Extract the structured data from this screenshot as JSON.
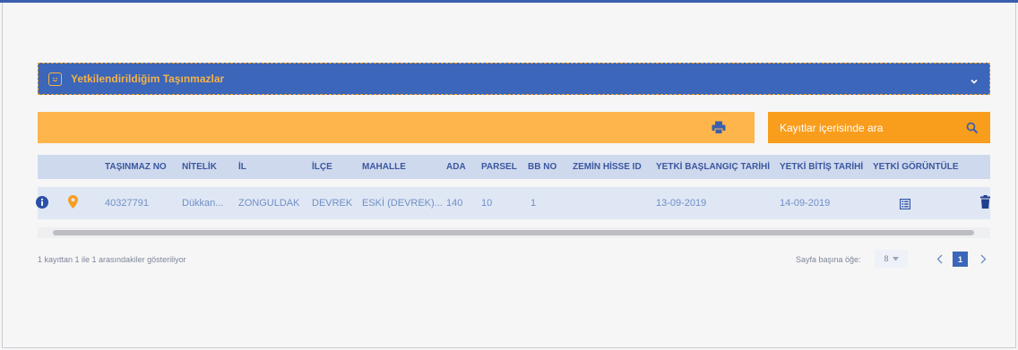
{
  "panel": {
    "title": "Yetkilendirildiğim Taşınmazlar"
  },
  "search": {
    "placeholder": "Kayıtlar içerisinde ara"
  },
  "table": {
    "headers": {
      "tasinmaz_no": "TAŞINMAZ NO",
      "nitelik": "NİTELİK",
      "il": "İL",
      "ilce": "İLÇE",
      "mahalle": "MAHALLE",
      "ada": "ADA",
      "parsel": "PARSEL",
      "bb_no": "BB NO",
      "zemin_hisse_id": "ZEMİN HİSSE ID",
      "yetki_baslangic": "YETKİ BAŞLANGIÇ TARİHİ",
      "yetki_bitis": "YETKİ BİTİŞ TARİHİ",
      "yetki_goruntule": "YETKİ GÖRÜNTÜLE"
    },
    "rows": [
      {
        "tasinmaz_no": "40327791",
        "nitelik": "Dükkan...",
        "il": "ZONGULDAK",
        "ilce": "DEVREK",
        "mahalle": "ESKİ (DEVREK)...",
        "ada": "140",
        "parsel": "10",
        "bb_no": "1",
        "zemin_hisse_id": "",
        "yetki_baslangic": "13-09-2019",
        "yetki_bitis": "14-09-2019"
      }
    ]
  },
  "footer": {
    "summary": "1 kayıttan 1 ile 1 arasındakiler gösteriliyor",
    "per_page_label": "Sayfa başına öğe:",
    "per_page_value": "8",
    "current_page": "1"
  },
  "icons": {
    "panel": "smile-icon",
    "collapse": "chevron-down-icon",
    "print": "print-icon",
    "search": "search-icon",
    "info": "info-icon",
    "location": "map-pin-icon",
    "view": "document-icon",
    "delete": "trash-icon"
  },
  "colors": {
    "primary_blue": "#3b66b9",
    "accent_orange": "#f99d1c",
    "toolbar_orange": "#fdb54c",
    "header_row": "#cfd9ed",
    "data_row": "#e0e7f4"
  }
}
